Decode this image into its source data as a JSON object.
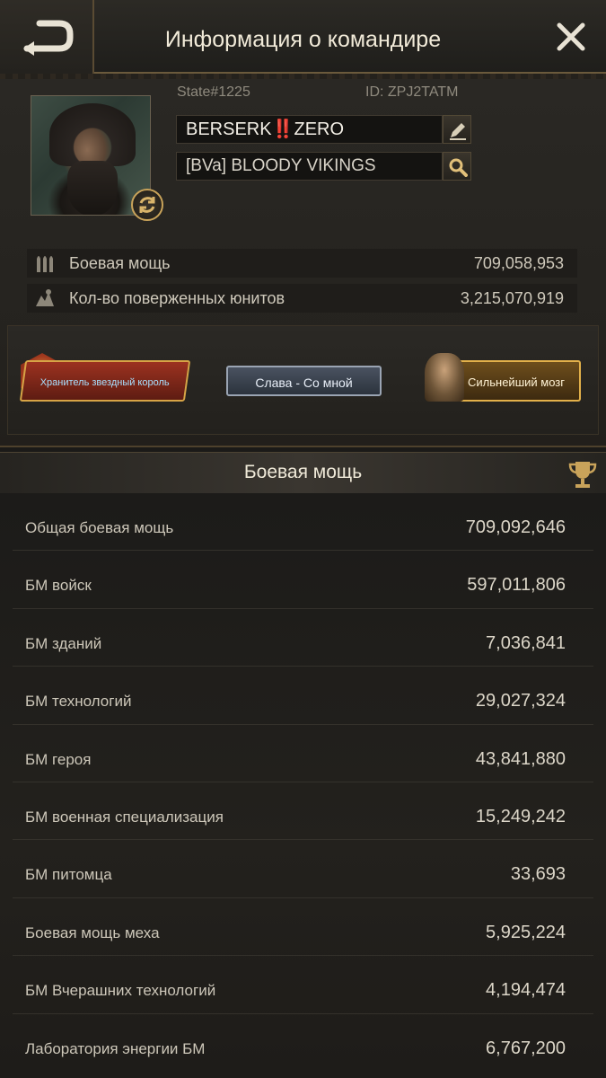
{
  "header": {
    "title": "Информация о командире",
    "back_icon": "back-arrow-icon",
    "close_icon": "close-icon"
  },
  "profile": {
    "state": "State#1225",
    "id": "ID: ZPJ2TATM",
    "name_prefix": "BERSERK",
    "name_mark": "‼️",
    "name_suffix": "ZERO",
    "alliance": "[BVa] BLOODY VIKINGS",
    "stats": [
      {
        "icon": "ammo-icon",
        "label": "Боевая мощь",
        "value": "709,058,953"
      },
      {
        "icon": "defeated-units-icon",
        "label": "Кол-во поверженных юнитов",
        "value": "3,215,070,919"
      }
    ]
  },
  "titles": [
    {
      "label": "Хранитель звездный король"
    },
    {
      "label": "Слава - Со мной"
    },
    {
      "label": "Сильнейший мозг"
    }
  ],
  "section": {
    "title": "Боевая мощь",
    "icon": "trophy-icon"
  },
  "power_rows": [
    {
      "label": "Общая боевая мощь",
      "value": "709,092,646"
    },
    {
      "label": "БМ войск",
      "value": "597,011,806"
    },
    {
      "label": "БМ зданий",
      "value": "7,036,841"
    },
    {
      "label": "БМ технологий",
      "value": "29,027,324"
    },
    {
      "label": "БМ героя",
      "value": "43,841,880"
    },
    {
      "label": "БМ военная специализация",
      "value": "15,249,242"
    },
    {
      "label": "БМ питомца",
      "value": "33,693"
    },
    {
      "label": "Боевая мощь меха",
      "value": "5,925,224"
    },
    {
      "label": "БМ Вчерашних технологий",
      "value": "4,194,474"
    },
    {
      "label": "Лаборатория энергии БМ",
      "value": "6,767,200"
    }
  ],
  "colors": {
    "accent_gold": "#c9a35a",
    "name_mark_red": "#e03030"
  }
}
